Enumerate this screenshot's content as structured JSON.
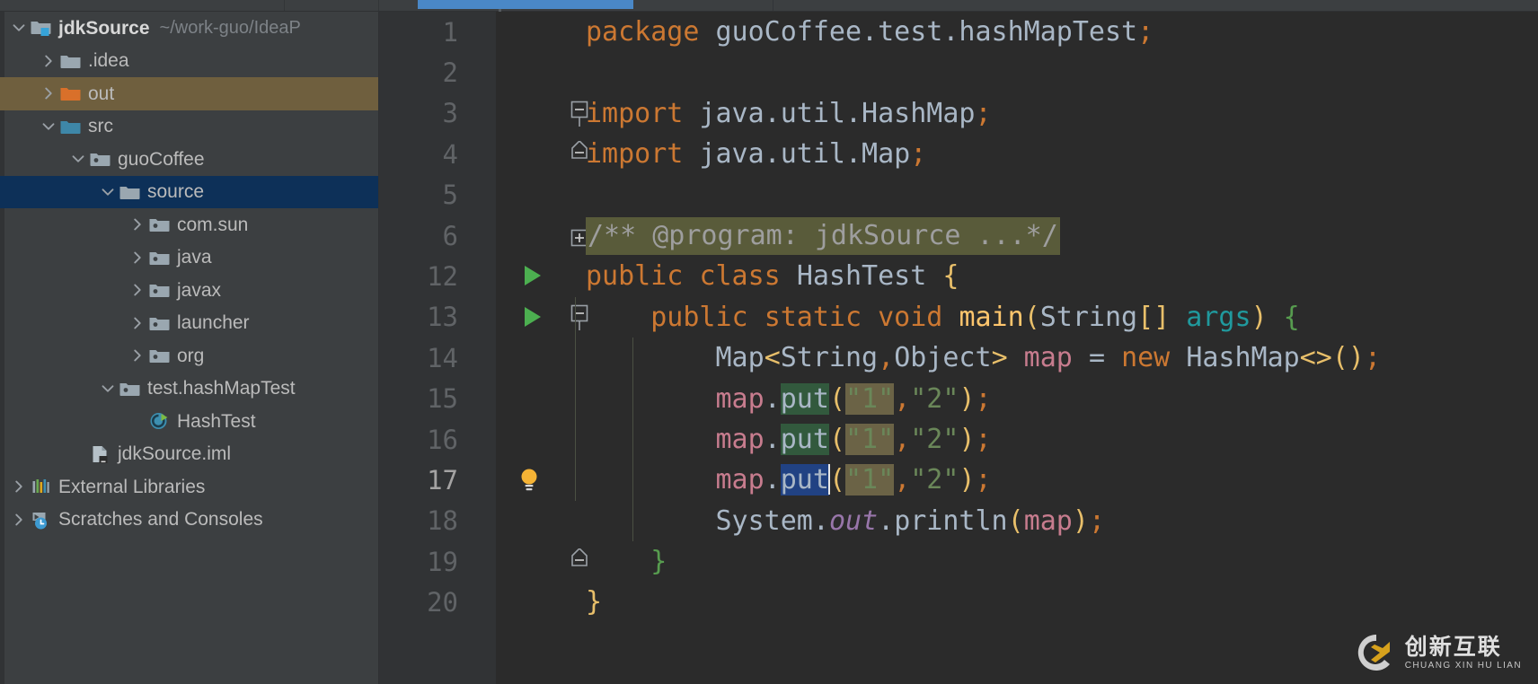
{
  "window": {
    "theme_bg": "#2b2b2b",
    "panel_bg": "#3c3f41",
    "accent": "#4a88c7"
  },
  "project_tree": {
    "items": [
      {
        "label": "jdkSource",
        "path": "~/work-guo/IdeaP",
        "arrow": "chevron-down",
        "icon": "module-folder-icon",
        "indent": 0,
        "state": "normal",
        "bold": true
      },
      {
        "label": ".idea",
        "path": "",
        "arrow": "chevron-right",
        "icon": "folder-icon",
        "indent": 1,
        "state": "normal",
        "bold": false
      },
      {
        "label": "out",
        "path": "",
        "arrow": "chevron-right",
        "icon": "folder-orange-icon",
        "indent": 1,
        "state": "highlight",
        "bold": false
      },
      {
        "label": "src",
        "path": "",
        "arrow": "chevron-down",
        "icon": "folder-blue-icon",
        "indent": 1,
        "state": "normal",
        "bold": false
      },
      {
        "label": "guoCoffee",
        "path": "",
        "arrow": "chevron-down",
        "icon": "package-icon",
        "indent": 2,
        "state": "normal",
        "bold": false
      },
      {
        "label": "source",
        "path": "",
        "arrow": "chevron-down",
        "icon": "folder-icon",
        "indent": 3,
        "state": "selected",
        "bold": false
      },
      {
        "label": "com.sun",
        "path": "",
        "arrow": "chevron-right",
        "icon": "package-icon",
        "indent": 4,
        "state": "normal",
        "bold": false
      },
      {
        "label": "java",
        "path": "",
        "arrow": "chevron-right",
        "icon": "package-icon",
        "indent": 4,
        "state": "normal",
        "bold": false
      },
      {
        "label": "javax",
        "path": "",
        "arrow": "chevron-right",
        "icon": "package-icon",
        "indent": 4,
        "state": "normal",
        "bold": false
      },
      {
        "label": "launcher",
        "path": "",
        "arrow": "chevron-right",
        "icon": "package-icon",
        "indent": 4,
        "state": "normal",
        "bold": false
      },
      {
        "label": "org",
        "path": "",
        "arrow": "chevron-right",
        "icon": "package-icon",
        "indent": 4,
        "state": "normal",
        "bold": false
      },
      {
        "label": "test.hashMapTest",
        "path": "",
        "arrow": "chevron-down",
        "icon": "package-icon",
        "indent": 3,
        "state": "normal",
        "bold": false
      },
      {
        "label": "HashTest",
        "path": "",
        "arrow": "none",
        "icon": "java-class-runnable-icon",
        "indent": 4,
        "state": "normal",
        "bold": false
      },
      {
        "label": "jdkSource.iml",
        "path": "",
        "arrow": "none",
        "icon": "iml-file-icon",
        "indent": 2,
        "state": "normal",
        "bold": false
      },
      {
        "label": "External Libraries",
        "path": "",
        "arrow": "chevron-right",
        "icon": "libraries-icon",
        "indent": 0,
        "state": "normal",
        "bold": false
      },
      {
        "label": "Scratches and Consoles",
        "path": "",
        "arrow": "chevron-right",
        "icon": "scratches-icon",
        "indent": 0,
        "state": "normal",
        "bold": false
      }
    ]
  },
  "editor": {
    "lines": [
      {
        "num": "1",
        "gutter": "none",
        "fold": "none",
        "current": false
      },
      {
        "num": "2",
        "gutter": "none",
        "fold": "none",
        "current": false
      },
      {
        "num": "3",
        "gutter": "none",
        "fold": "collapse-top",
        "current": false
      },
      {
        "num": "4",
        "gutter": "none",
        "fold": "collapse-bottom",
        "current": false
      },
      {
        "num": "5",
        "gutter": "none",
        "fold": "none",
        "current": false
      },
      {
        "num": "6",
        "gutter": "none",
        "fold": "expand",
        "current": false
      },
      {
        "num": "12",
        "gutter": "run",
        "fold": "none",
        "current": false
      },
      {
        "num": "13",
        "gutter": "run",
        "fold": "collapse-top",
        "current": false
      },
      {
        "num": "14",
        "gutter": "none",
        "fold": "none",
        "current": false
      },
      {
        "num": "15",
        "gutter": "none",
        "fold": "none",
        "current": false
      },
      {
        "num": "16",
        "gutter": "none",
        "fold": "none",
        "current": false
      },
      {
        "num": "17",
        "gutter": "bulb",
        "fold": "none",
        "current": true
      },
      {
        "num": "18",
        "gutter": "none",
        "fold": "none",
        "current": false
      },
      {
        "num": "19",
        "gutter": "none",
        "fold": "collapse-bottom",
        "current": false
      },
      {
        "num": "20",
        "gutter": "none",
        "fold": "none",
        "current": false
      }
    ],
    "code": {
      "l1_kw": "package",
      "l1_pkg": " guoCoffee.test.hashMapTest",
      "l1_semi": ";",
      "l3_kw": "import",
      "l3_pkg": " java.util.HashMap",
      "l3_semi": ";",
      "l4_kw": "import",
      "l4_pkg": " java.util.Map",
      "l4_semi": ";",
      "l6_folded": "/** @program: jdkSource ...*/",
      "l12_public": "public ",
      "l12_class": "class ",
      "l12_name": "HashTest ",
      "l12_brace": "{",
      "l13_indent": "    ",
      "l13_public": "public ",
      "l13_static": "static ",
      "l13_void": "void ",
      "l13_main": "main",
      "l13_p1": "(",
      "l13_string": "String",
      "l13_brackets": "[]",
      "l13_args": " args",
      "l13_p2": ")",
      "l13_brace": " {",
      "l14_indent": "        ",
      "l14_map": "Map",
      "l14_lt": "<",
      "l14_generic": "String",
      "l14_comma": ",",
      "l14_obj": "Object",
      "l14_gt": ">",
      "l14_var": " map ",
      "l14_eq": "= ",
      "l14_new": "new ",
      "l14_hm": "HashMap",
      "l14_diamond": "<>",
      "l14_call": "()",
      "l14_semi": ";",
      "l15_indent": "        ",
      "l15_map": "map",
      "l15_dot": ".",
      "l15_put": "put",
      "l15_open": "(",
      "l15_k": "\"1\"",
      "l15_comma": ",",
      "l15_v": "\"2\"",
      "l15_close": ")",
      "l15_semi": ";",
      "l18_indent": "        ",
      "l18_system": "System",
      "l18_dot1": ".",
      "l18_out": "out",
      "l18_dot2": ".",
      "l18_println": "println",
      "l18_open": "(",
      "l18_arg": "map",
      "l18_close": ")",
      "l18_semi": ";",
      "l19_indent": "    ",
      "l19_brace": "}",
      "l20_brace": "}"
    },
    "selection": {
      "selected_token": "put",
      "usage_token": "put",
      "search_token": "\"1\""
    }
  },
  "watermark": {
    "cn": "创新互联",
    "pinyin": "CHUANG XIN HU LIAN",
    "mark": "CX"
  }
}
